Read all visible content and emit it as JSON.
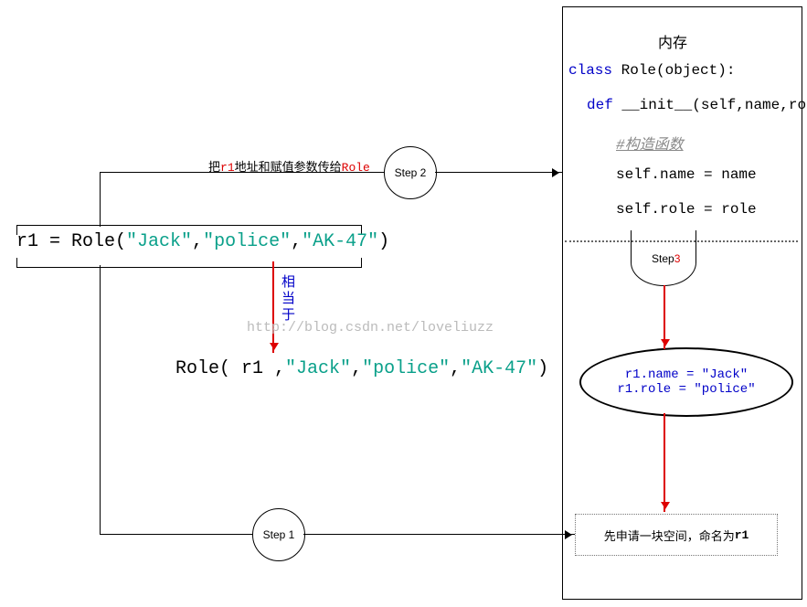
{
  "memory": {
    "title": "内存",
    "code": {
      "class_kw": "class",
      "class_name": " Role",
      "class_paren": "(object):",
      "def_kw": "def",
      "init": " __init__",
      "init_args": "(self,name,role,",
      "comment": "#构造函数",
      "assign1_l": "self.",
      "assign1_m": "name = name",
      "assign2_l": "self.",
      "assign2_m": "role = role"
    }
  },
  "assignment": {
    "lhs": "r1 = Role(",
    "arg1": "\"Jack\"",
    "sep1": ",",
    "arg2": "\"police\"",
    "sep2": ",",
    "arg3": "\"AK-47\"",
    "close": ")"
  },
  "equivalence": {
    "label": "相当于"
  },
  "expanded": {
    "head": "Role( ",
    "r1": "r1",
    "rest1": " ,",
    "arg1": "\"Jack\"",
    "sep1": ",",
    "arg2": "\"police\"",
    "sep2": ",",
    "arg3": "\"AK-47\"",
    "close": ")"
  },
  "steps": {
    "s1": "Step 1",
    "s2": "Step 2",
    "s3a": "Step",
    "s3b": "3"
  },
  "step2_label": {
    "pre": "把",
    "r1": "r1",
    "mid": "地址和赋值参数传给",
    "role": "Role"
  },
  "dotted": {
    "pre": "先申请一块空间，命名为",
    "r1": "r1"
  },
  "ellipse": {
    "l1": "r1.name = \"Jack\"",
    "l2": "r1.role = \"police\""
  },
  "watermark": "http://blog.csdn.net/loveliuzz"
}
